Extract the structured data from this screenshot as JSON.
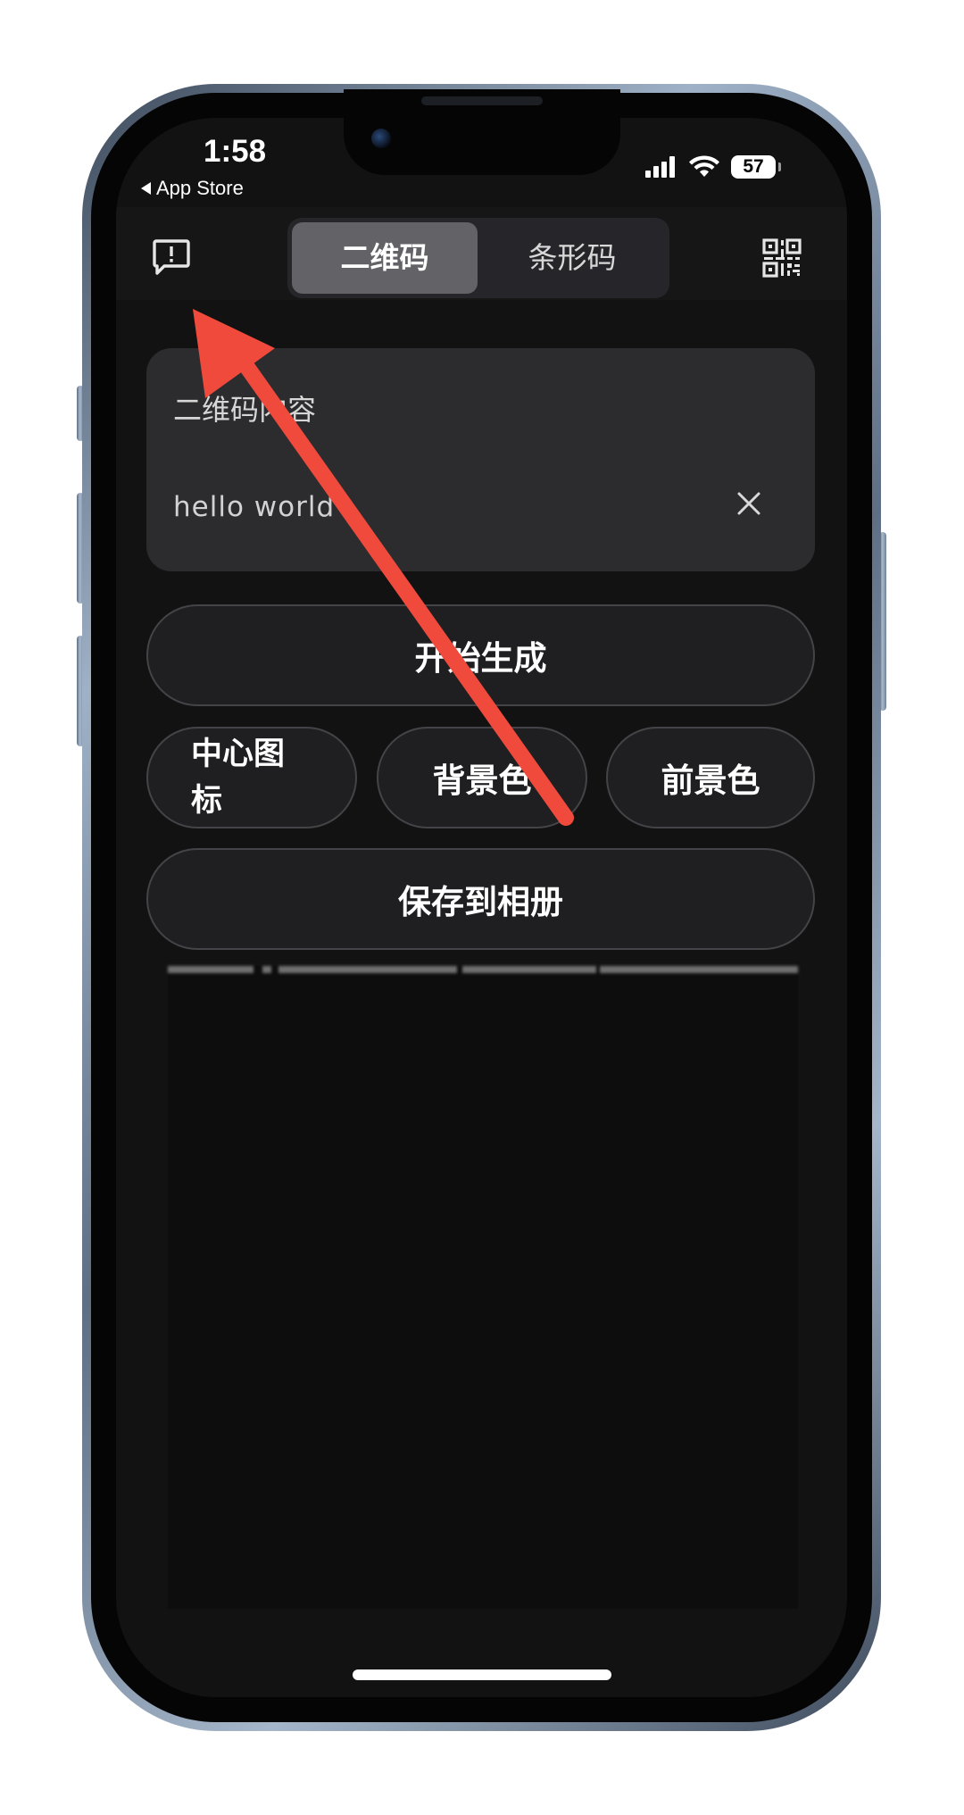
{
  "status_bar": {
    "time": "1:58",
    "back_label": "App Store",
    "battery": "57"
  },
  "nav": {
    "tabs": [
      {
        "label": "二维码",
        "active": true
      },
      {
        "label": "条形码",
        "active": false
      }
    ],
    "left_icon": "feedback-icon",
    "right_icon": "qr-scan-icon"
  },
  "content_card": {
    "label": "二维码内容",
    "value": "hello world",
    "clear_icon": "close-icon"
  },
  "buttons": {
    "generate": "开始生成",
    "center_icon": "中心图标",
    "background_color": "背景色",
    "foreground_color": "前景色",
    "save_to_album": "保存到相册"
  },
  "colors": {
    "screen_bg": "#121212",
    "card_bg": "#2c2c2e",
    "segment_active": "#626267",
    "annotation_arrow": "#f04a3c"
  }
}
